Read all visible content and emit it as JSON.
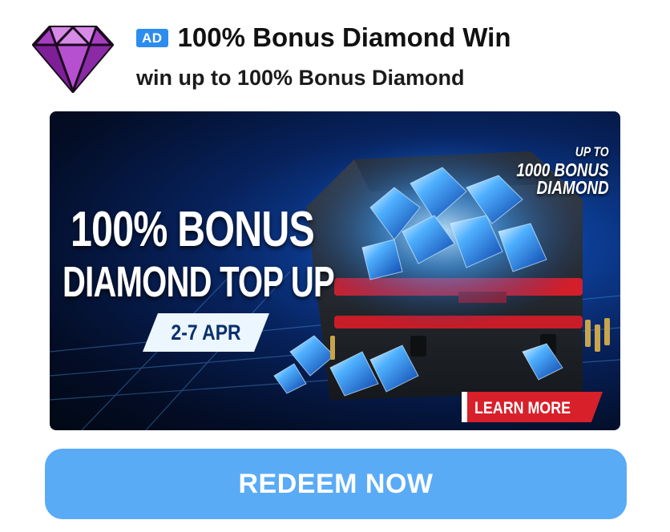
{
  "ad": {
    "badge": "AD",
    "title": "100% Bonus Diamond Win",
    "subtitle": "win up to 100% Bonus Diamond",
    "icon": "diamond-icon"
  },
  "banner": {
    "headline_line1": "100% BONUS",
    "headline_line2": "DIAMOND TOP UP",
    "date": "2-7 APR",
    "corner_note_line1": "UP TO",
    "corner_note_line2": "1000 BONUS",
    "corner_note_line3": "DIAMOND",
    "learn_more": "LEARN MORE"
  },
  "cta": {
    "label": "REDEEM NOW"
  },
  "colors": {
    "badge": "#2c8cf0",
    "icon_purple": "#a034b8",
    "banner_background": "#07215a",
    "learn_more_red": "#d8202a",
    "cta_blue": "#5aabf6"
  }
}
